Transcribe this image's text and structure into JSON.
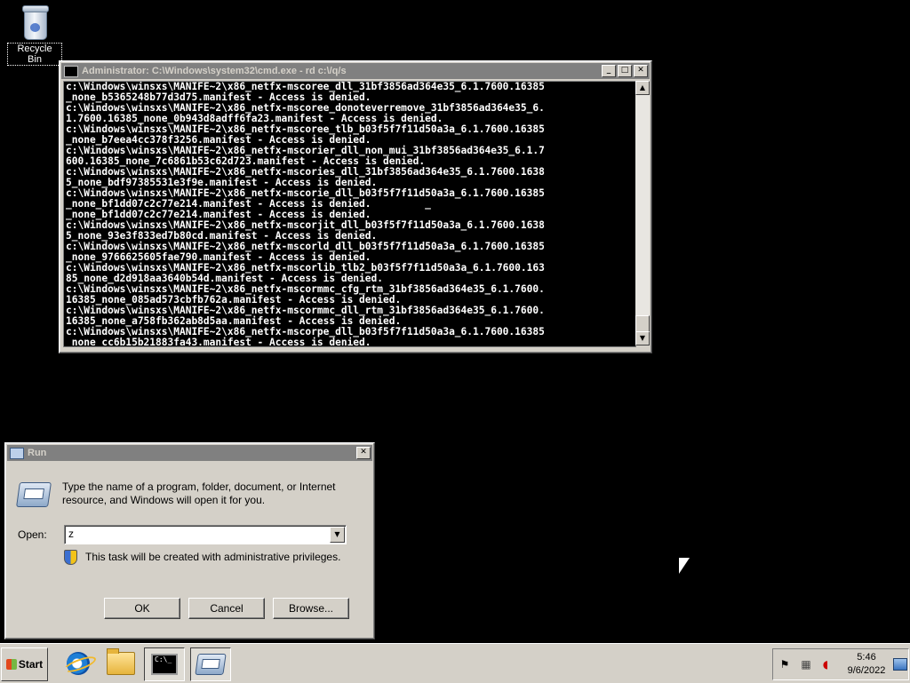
{
  "desktop": {
    "recycle_bin_label": "Recycle Bin"
  },
  "cmd_window": {
    "title": "Administrator: C:\\Windows\\system32\\cmd.exe - rd  c:\\/q/s",
    "lines": [
      "c:\\Windows\\winsxs\\MANIFE~2\\x86_netfx-mscoree_dll_31bf3856ad364e35_6.1.7600.16385",
      "_none_b5365248b77d3d75.manifest - Access is denied.",
      "c:\\Windows\\winsxs\\MANIFE~2\\x86_netfx-mscoree_donoteverremove_31bf3856ad364e35_6.",
      "1.7600.16385_none_0b943d8adff6fa23.manifest - Access is denied.",
      "c:\\Windows\\winsxs\\MANIFE~2\\x86_netfx-mscoree_tlb_b03f5f7f11d50a3a_6.1.7600.16385",
      "_none_b7eea4cc378f3256.manifest - Access is denied.",
      "c:\\Windows\\winsxs\\MANIFE~2\\x86_netfx-mscorier_dll_non_mui_31bf3856ad364e35_6.1.7",
      "600.16385_none_7c6861b53c62d723.manifest - Access is denied.",
      "c:\\Windows\\winsxs\\MANIFE~2\\x86_netfx-mscories_dll_31bf3856ad364e35_6.1.7600.1638",
      "5_none_bdf97385531e3f9e.manifest - Access is denied.",
      "c:\\Windows\\winsxs\\MANIFE~2\\x86_netfx-mscorie_dll_b03f5f7f11d50a3a_6.1.7600.16385",
      "_none_bf1dd07c2c77e214.manifest - Access is denied.         _",
      "_none_bf1dd07c2c77e214.manifest - Access is denied.",
      "c:\\Windows\\winsxs\\MANIFE~2\\x86_netfx-mscorjit_dll_b03f5f7f11d50a3a_6.1.7600.1638",
      "5_none_93e3f833ed7b80cd.manifest - Access is denied.",
      "c:\\Windows\\winsxs\\MANIFE~2\\x86_netfx-mscorld_dll_b03f5f7f11d50a3a_6.1.7600.16385",
      "_none_9766625605fae790.manifest - Access is denied.",
      "c:\\Windows\\winsxs\\MANIFE~2\\x86_netfx-mscorlib_tlb2_b03f5f7f11d50a3a_6.1.7600.163",
      "85_none_d2d918aa3640b54d.manifest - Access is denied.",
      "c:\\Windows\\winsxs\\MANIFE~2\\x86_netfx-mscormmc_cfg_rtm_31bf3856ad364e35_6.1.7600.",
      "16385_none_085ad573cbfb762a.manifest - Access is denied.",
      "c:\\Windows\\winsxs\\MANIFE~2\\x86_netfx-mscormmc_dll_rtm_31bf3856ad364e35_6.1.7600.",
      "16385_none_a758fb362ab8d5aa.manifest - Access is denied.",
      "c:\\Windows\\winsxs\\MANIFE~2\\x86_netfx-mscorpe_dll_b03f5f7f11d50a3a_6.1.7600.16385",
      "_none_cc6b15b21883fa43.manifest - Access is denied."
    ]
  },
  "run_dialog": {
    "title": "Run",
    "description": "Type the name of a program, folder, document, or Internet resource, and Windows will open it for you.",
    "open_label": "Open:",
    "open_value": "z",
    "admin_note": "This task will be created with administrative privileges.",
    "ok_label": "OK",
    "cancel_label": "Cancel",
    "browse_label": "Browse..."
  },
  "taskbar": {
    "start_label": "Start",
    "cmd_icon_text": "C:\\_",
    "clock_time": "5:46",
    "clock_date": "9/6/2022"
  }
}
